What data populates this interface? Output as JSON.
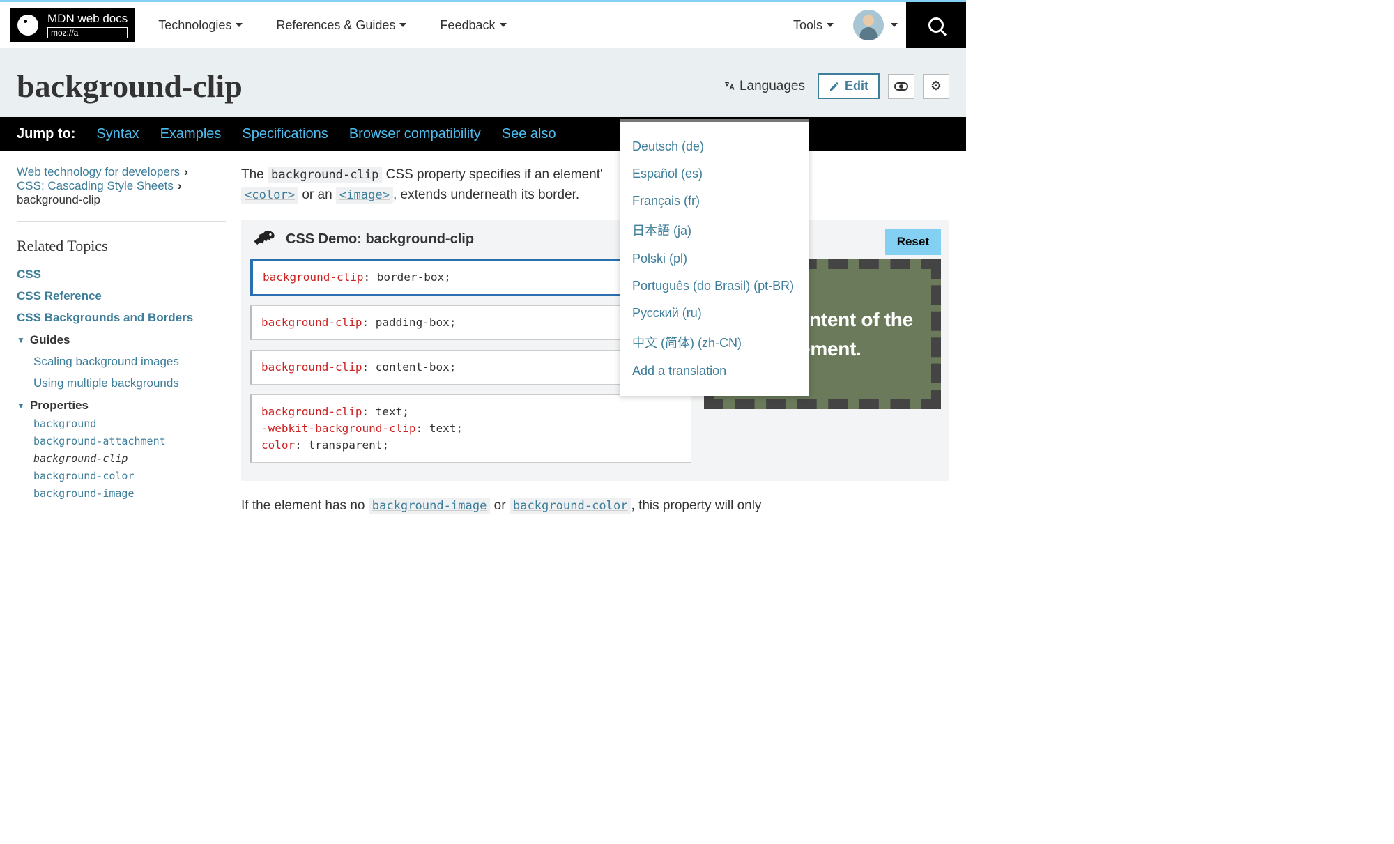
{
  "nav": {
    "technologies": "Technologies",
    "references": "References & Guides",
    "feedback": "Feedback",
    "tools": "Tools"
  },
  "page": {
    "title": "background-clip",
    "languages_label": "Languages",
    "edit_label": "Edit"
  },
  "languages": {
    "items": [
      "Deutsch (de)",
      "Español (es)",
      "Français (fr)",
      "日本語 (ja)",
      "Polski (pl)",
      "Português (do Brasil) (pt-BR)",
      "Русский (ru)",
      "中文 (简体) (zh-CN)",
      "Add a translation"
    ]
  },
  "jump": {
    "label": "Jump to:",
    "items": [
      "Syntax",
      "Examples",
      "Specifications",
      "Browser compatibility",
      "See also"
    ]
  },
  "breadcrumb": {
    "a": "Web technology for developers",
    "b": "CSS: Cascading Style Sheets",
    "c": "background-clip"
  },
  "related": {
    "heading": "Related Topics",
    "css": "CSS",
    "ref": "CSS Reference",
    "bgb": "CSS Backgrounds and Borders",
    "guides": "Guides",
    "g1": "Scaling background images",
    "g2": "Using multiple backgrounds",
    "props": "Properties",
    "p1": "background",
    "p2": "background-attachment",
    "p3": "background-clip",
    "p4": "background-color",
    "p5": "background-image"
  },
  "intro": {
    "t1": "The ",
    "c1": "background-clip",
    "t2": " CSS property specifies if an element'",
    "c2": "<color>",
    "t3": " or an ",
    "c3": "<image>",
    "t4": ", extends underneath its border."
  },
  "demo": {
    "title": "CSS Demo: background-clip",
    "reset": "Reset",
    "code1": {
      "prop": "background-clip",
      "val": "border-box"
    },
    "code2": {
      "prop": "background-clip",
      "val": "padding-box"
    },
    "code3": {
      "prop": "background-clip",
      "val": "content-box"
    },
    "code4": {
      "l1p": "background-clip",
      "l1v": "text",
      "l2p": "-webkit-background-clip",
      "l2v": "text",
      "l3p": "color",
      "l3v": "transparent"
    },
    "preview_text": "is the content of the element."
  },
  "outro": {
    "t1": "If the element has no ",
    "c1": "background-image",
    "t2": " or ",
    "c2": "background-color",
    "t3": ", this property will only"
  }
}
